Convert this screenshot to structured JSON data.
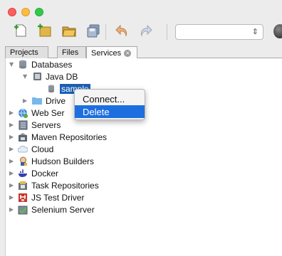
{
  "colors": {
    "selection": "#1a5fb4",
    "menu_highlight": "#1d6fe0",
    "traffic_close": "#fc605c",
    "traffic_minimize": "#fdbc40",
    "traffic_maximize": "#34c84a"
  },
  "toolbar": {
    "buttons": [
      "new-file-icon",
      "new-project-icon",
      "open-project-icon",
      "save-all-icon",
      "undo-icon",
      "redo-icon"
    ],
    "config_select_value": ""
  },
  "tabs": [
    {
      "label": "Projects",
      "active": false
    },
    {
      "label": "Files",
      "active": false
    },
    {
      "label": "Services",
      "active": true
    }
  ],
  "tree": {
    "databases": "Databases",
    "java_db": "Java DB",
    "sample": "sample",
    "drivers_partial": "Drive",
    "web_services_partial": "Web Ser",
    "servers": "Servers",
    "maven_repositories": "Maven Repositories",
    "cloud": "Cloud",
    "hudson_builders": "Hudson Builders",
    "docker": "Docker",
    "task_repositories": "Task Repositories",
    "js_test_driver": "JS Test Driver",
    "selenium_server": "Selenium Server"
  },
  "context_menu": {
    "connect": "Connect...",
    "delete": "Delete"
  }
}
